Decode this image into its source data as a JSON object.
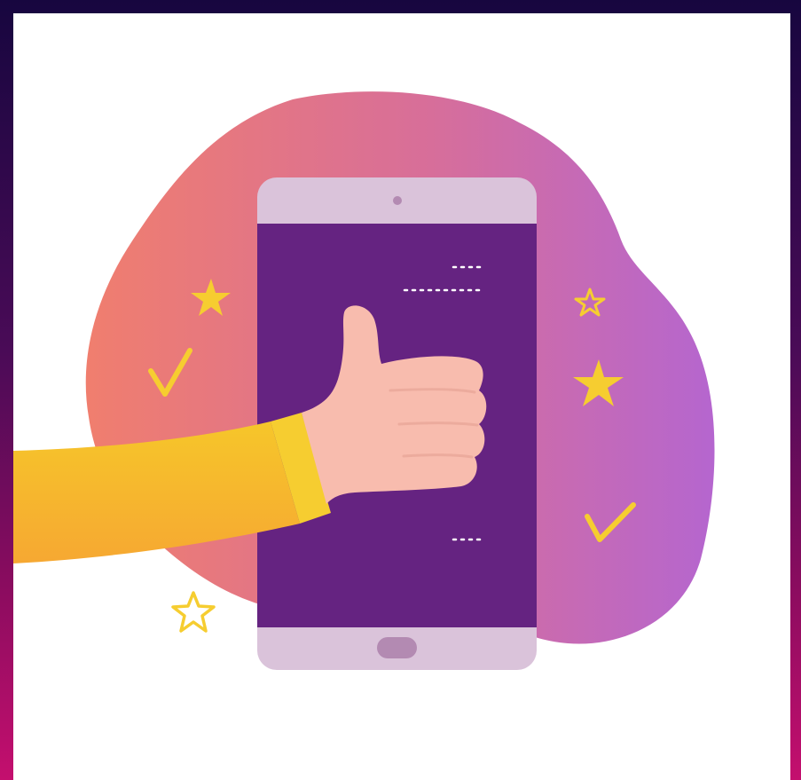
{
  "illustration": {
    "subject": "thumbs-up",
    "colors": {
      "frame_top": "#17063f",
      "frame_bottom": "#c40f6e",
      "card_background": "#ffffff",
      "blob_left": "#f07e6e",
      "blob_right": "#b566cf",
      "phone_body": "#dac3da",
      "phone_screen": "#652381",
      "phone_button": "#b38ab2",
      "sleeve": "#f6bd2a",
      "skin": "#f8bcae",
      "star": "#f6cd30",
      "check": "#f6cd30"
    },
    "icons": [
      "phone-icon",
      "thumbs-up-icon",
      "star-icon",
      "check-icon"
    ]
  }
}
